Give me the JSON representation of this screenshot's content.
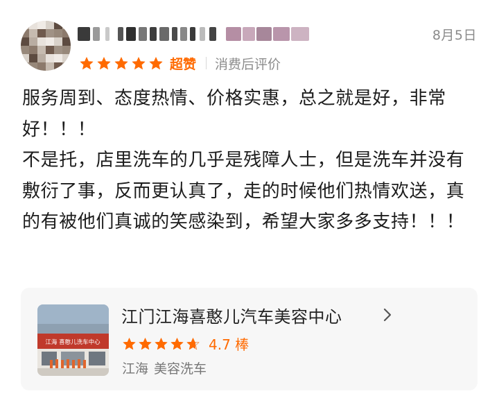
{
  "review": {
    "date": "8月5日",
    "rating": 5,
    "rating_max": 5,
    "badge": "超赞",
    "tag": "消费后评价",
    "paragraphs": [
      "服务周到、态度热情、价格实惠，总之就是好，非常好！！！",
      "不是托，店里洗车的几乎是残障人士，但是洗车并没有敷衍了事，反而更认真了，走的时候他们热情欢送，真的有被他们真诚的笑感染到，希望大家多多支持！！！"
    ]
  },
  "store": {
    "name": "江门江海喜憨儿汽车美容中心",
    "rating": 4.7,
    "score_text": "4.7 棒",
    "area": "江海",
    "category": "美容洗车",
    "thumb_sign": "江海 喜憨儿洗车中心"
  },
  "colors": {
    "accent": "#ff6a00",
    "star_empty": "#e6e6e6",
    "card_bg": "#f7f7f7"
  },
  "icons": {
    "star": "star-icon",
    "chevron": "chevron-right-icon"
  }
}
